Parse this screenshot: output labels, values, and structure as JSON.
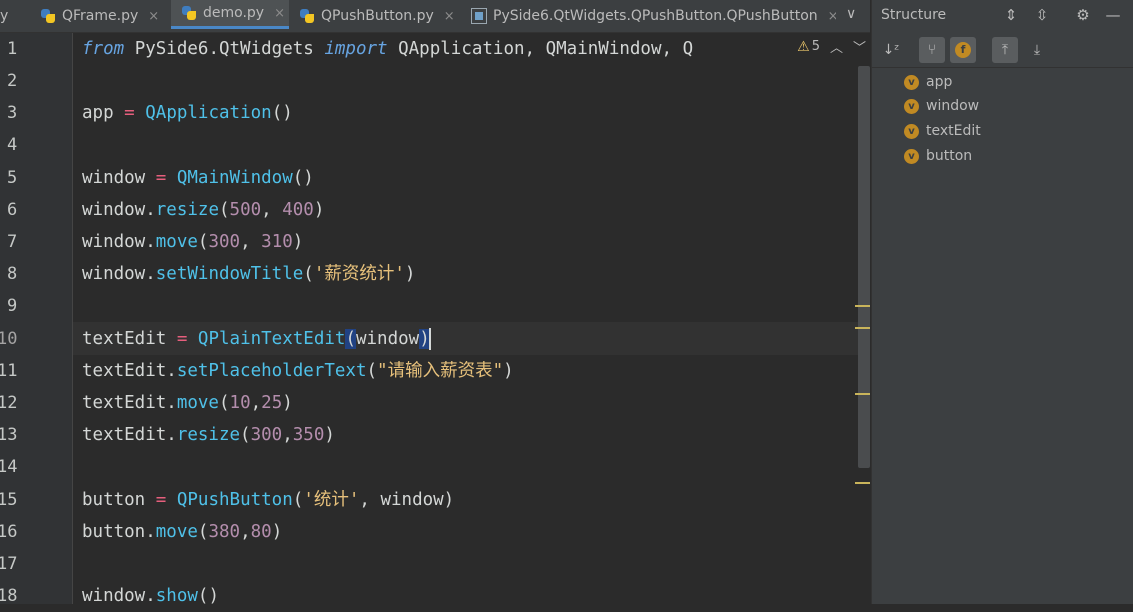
{
  "tabs": [
    {
      "label": "y",
      "close": ""
    },
    {
      "label": "QFrame.py",
      "close": "×"
    },
    {
      "label": "demo.py",
      "close": "×"
    },
    {
      "label": "QPushButton.py",
      "close": "×"
    },
    {
      "label": "PySide6.QtWidgets.QPushButton.QPushButton",
      "close": "×"
    }
  ],
  "tab_overflow": "∨",
  "inspections": {
    "warning_count": "5"
  },
  "line_numbers": [
    "1",
    "2",
    "3",
    "4",
    "5",
    "6",
    "7",
    "8",
    "9",
    "10",
    "11",
    "12",
    "13",
    "14",
    "15",
    "16",
    "17",
    "18"
  ],
  "code": {
    "l1": {
      "kw1": "from",
      "mod": " PySide6.QtWidgets ",
      "kw2": "import",
      "rest": " QApplication, QMainWindow, Q"
    },
    "l3": {
      "a": "app ",
      "op": "=",
      "b": " ",
      "cls": "QApplication",
      "c": "()"
    },
    "l5": {
      "a": "window ",
      "op": "=",
      "b": " ",
      "cls": "QMainWindow",
      "c": "()"
    },
    "l6": {
      "a": "window.",
      "fn": "resize",
      "b": "(",
      "n1": "500",
      "c": ", ",
      "n2": "400",
      "d": ")"
    },
    "l7": {
      "a": "window.",
      "fn": "move",
      "b": "(",
      "n1": "300",
      "c": ", ",
      "n2": "310",
      "d": ")"
    },
    "l8": {
      "a": "window.",
      "fn": "setWindowTitle",
      "b": "(",
      "s": "'薪资统计'",
      "d": ")"
    },
    "l10": {
      "a": "textEdit ",
      "op": "=",
      "b": " ",
      "cls": "QPlainTextEdit",
      "p1": "(",
      "c": "window",
      "p2": ")"
    },
    "l11": {
      "a": "textEdit.",
      "fn": "setPlaceholderText",
      "b": "(",
      "s": "\"请输入薪资表\"",
      "d": ")"
    },
    "l12": {
      "a": "textEdit.",
      "fn": "move",
      "b": "(",
      "n1": "10",
      "c": ",",
      "n2": "25",
      "d": ")"
    },
    "l13": {
      "a": "textEdit.",
      "fn": "resize",
      "b": "(",
      "n1": "300",
      "c": ",",
      "n2": "350",
      "d": ")"
    },
    "l15": {
      "a": "button ",
      "op": "=",
      "b": " ",
      "cls": "QPushButton",
      "p": "(",
      "s": "'统计'",
      "c": ", window)"
    },
    "l16": {
      "a": "button.",
      "fn": "move",
      "b": "(",
      "n1": "380",
      "c": ",",
      "n2": "80",
      "d": ")"
    },
    "l18": {
      "a": "window.",
      "fn": "show",
      "b": "()"
    }
  },
  "structure": {
    "title": "Structure",
    "items": [
      {
        "badge": "v",
        "label": "app"
      },
      {
        "badge": "v",
        "label": "window"
      },
      {
        "badge": "v",
        "label": "textEdit"
      },
      {
        "badge": "v",
        "label": "button"
      }
    ],
    "toolbar_f_badge": "f"
  },
  "colors": {
    "accent": "#4a88c7",
    "keyword": "#67a4e1",
    "operator": "#e75f7d",
    "class": "#4fc1e9",
    "number": "#b48ead",
    "string": "#e6c07b"
  }
}
